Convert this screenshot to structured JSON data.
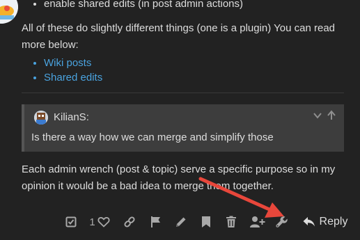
{
  "post": {
    "top_bullet": "enable shared edits (in post admin actions)",
    "intro": "All of these do slightly different things (one is a plugin) You can read more below:",
    "links": [
      {
        "label": "Wiki posts"
      },
      {
        "label": "Shared edits"
      }
    ],
    "quote": {
      "author": "KilianS:",
      "text": "Is there a way how we can merge and simplify those"
    },
    "reply": "Each admin wrench (post & topic) serve a specific purpose so in my opinion it would be a bad idea to merge them together."
  },
  "actions": {
    "like_count": "1",
    "reply_label": "Reply"
  },
  "colors": {
    "background": "#222222",
    "link": "#4aa3df",
    "quote_bg": "#3d3d3d",
    "icon": "#a8a8a8",
    "annotation_arrow": "#e8473b"
  },
  "icons": [
    "select-post-icon",
    "heart-icon",
    "link-icon",
    "flag-icon",
    "pencil-icon",
    "bookmark-icon",
    "trash-icon",
    "add-user-icon",
    "wrench-icon",
    "reply-icon",
    "chevron-down-icon",
    "arrow-up-icon"
  ]
}
